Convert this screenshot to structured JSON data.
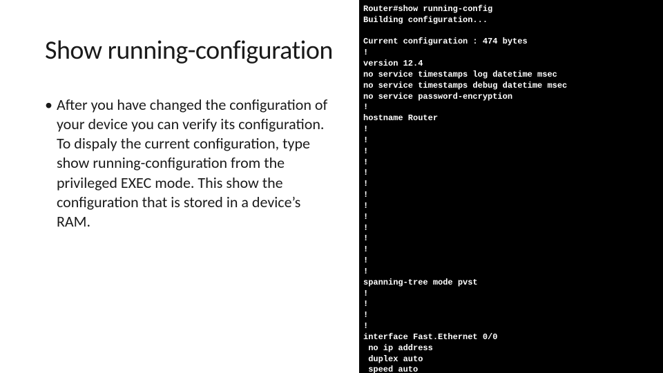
{
  "slide": {
    "title": "Show running-configuration",
    "bullet": "After you have changed the configuration of your device you can verify its configuration. To dispaly the current configuration, type show running-configuration from the privileged EXEC mode. This show the configuration that is stored in a device’s RAM."
  },
  "terminal": {
    "lines": "Router#show running-config\nBuilding configuration...\n\nCurrent configuration : 474 bytes\n!\nversion 12.4\nno service timestamps log datetime msec\nno service timestamps debug datetime msec\nno service password-encryption\n!\nhostname Router\n!\n!\n!\n!\n!\n!\n!\n!\n!\n!\n!\n!\n!\n!\nspanning-tree mode pvst\n!\n!\n!\n!\ninterface Fast.Ethernet 0/0\n no ip address\n duplex auto\n speed auto\n shutdown"
  }
}
